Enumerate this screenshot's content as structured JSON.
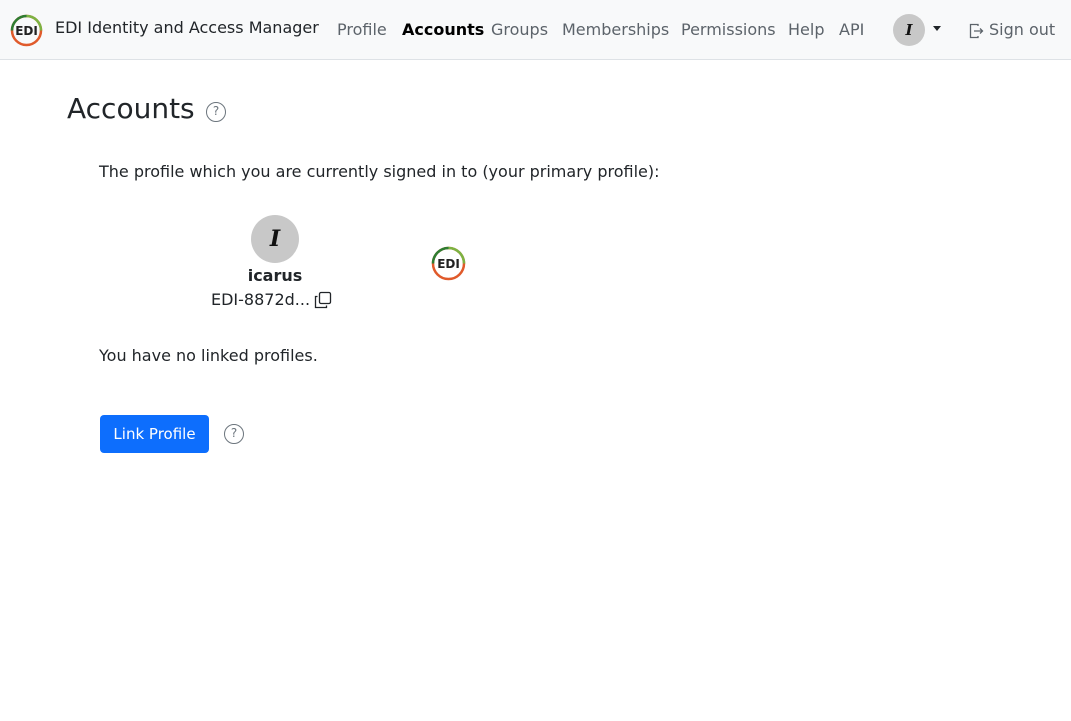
{
  "app": {
    "title": "EDI Identity and Access Manager"
  },
  "nav": {
    "items": [
      {
        "label": "Profile",
        "active": false
      },
      {
        "label": "Accounts",
        "active": true
      },
      {
        "label": "Groups",
        "active": false
      },
      {
        "label": "Memberships",
        "active": false
      },
      {
        "label": "Permissions",
        "active": false
      },
      {
        "label": "Help",
        "active": false
      },
      {
        "label": "API",
        "active": false
      }
    ],
    "user_initial": "I",
    "signout_label": "Sign out"
  },
  "page": {
    "title": "Accounts",
    "help_glyph": "?",
    "intro": "The profile which you are currently signed in to (your primary profile):",
    "primary_profile": {
      "initial": "I",
      "name": "icarus",
      "id": "EDI-8872d..."
    },
    "no_linked_text": "You have no linked profiles.",
    "link_button_label": "Link Profile"
  },
  "colors": {
    "accent": "#0d6efd",
    "navbar_bg": "#f8f9fa",
    "avatar_bg": "#c8c8c8"
  }
}
